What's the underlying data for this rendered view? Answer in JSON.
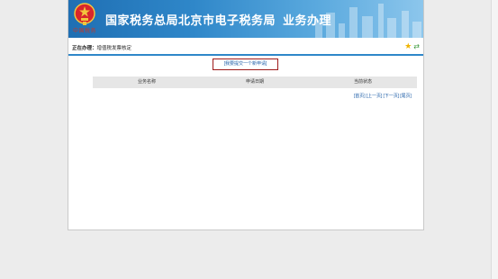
{
  "header": {
    "title": "国家税务总局北京市电子税务局",
    "subtitle": "业务办理",
    "emblem_text": "中国税务"
  },
  "current": {
    "prefix": "正在办理：",
    "business": "增值税发票核定"
  },
  "actions": {
    "new_application": "[我要提交一个新申请]"
  },
  "table": {
    "columns": [
      "业务名称",
      "申请日期",
      "当前状态"
    ],
    "rows": []
  },
  "pager": {
    "first": "[首页]",
    "prev": "[上一页]",
    "next": "[下一页]",
    "last": "[尾页]"
  },
  "colors": {
    "banner_start": "#1f6fb3",
    "banner_end": "#8cc6ec",
    "accent_line": "#2f87c9",
    "box_border": "#9e1a1a",
    "link": "#1f5fa8"
  },
  "icons": [
    "national-emblem-icon",
    "star-icon",
    "refresh-icon"
  ]
}
